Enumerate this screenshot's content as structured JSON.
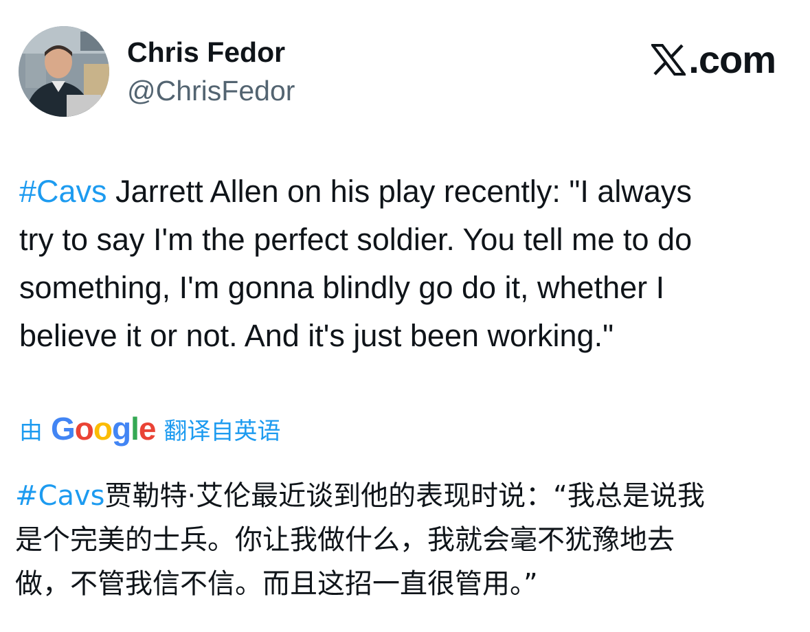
{
  "author": {
    "display_name": "Chris Fedor",
    "handle": "@ChrisFedor"
  },
  "brand": {
    "logo_icon": "x-logo-icon",
    "domain": ".com"
  },
  "tweet": {
    "hashtag": "#Cavs",
    "lines": [
      " Jarrett Allen on his play recently: \"I always",
      "try to say I'm the perfect soldier. You tell me to do",
      "something, I'm gonna blindly go do it, whether I",
      "believe it or not. And it's just been working.\""
    ]
  },
  "translation": {
    "by_label": "由",
    "provider": "Google",
    "from_label": "翻译自英语",
    "hashtag": "#Cavs",
    "lines": [
      "贾勒特·艾伦最近谈到他的表现时说：“我总是说我",
      "是个完美的士兵。你让我做什么，我就会毫不犹豫地去",
      "做，不管我信不信。而且这招一直很管用。”"
    ]
  },
  "colors": {
    "link": "#1d9bf0",
    "text": "#0f1419",
    "secondary": "#536471"
  }
}
